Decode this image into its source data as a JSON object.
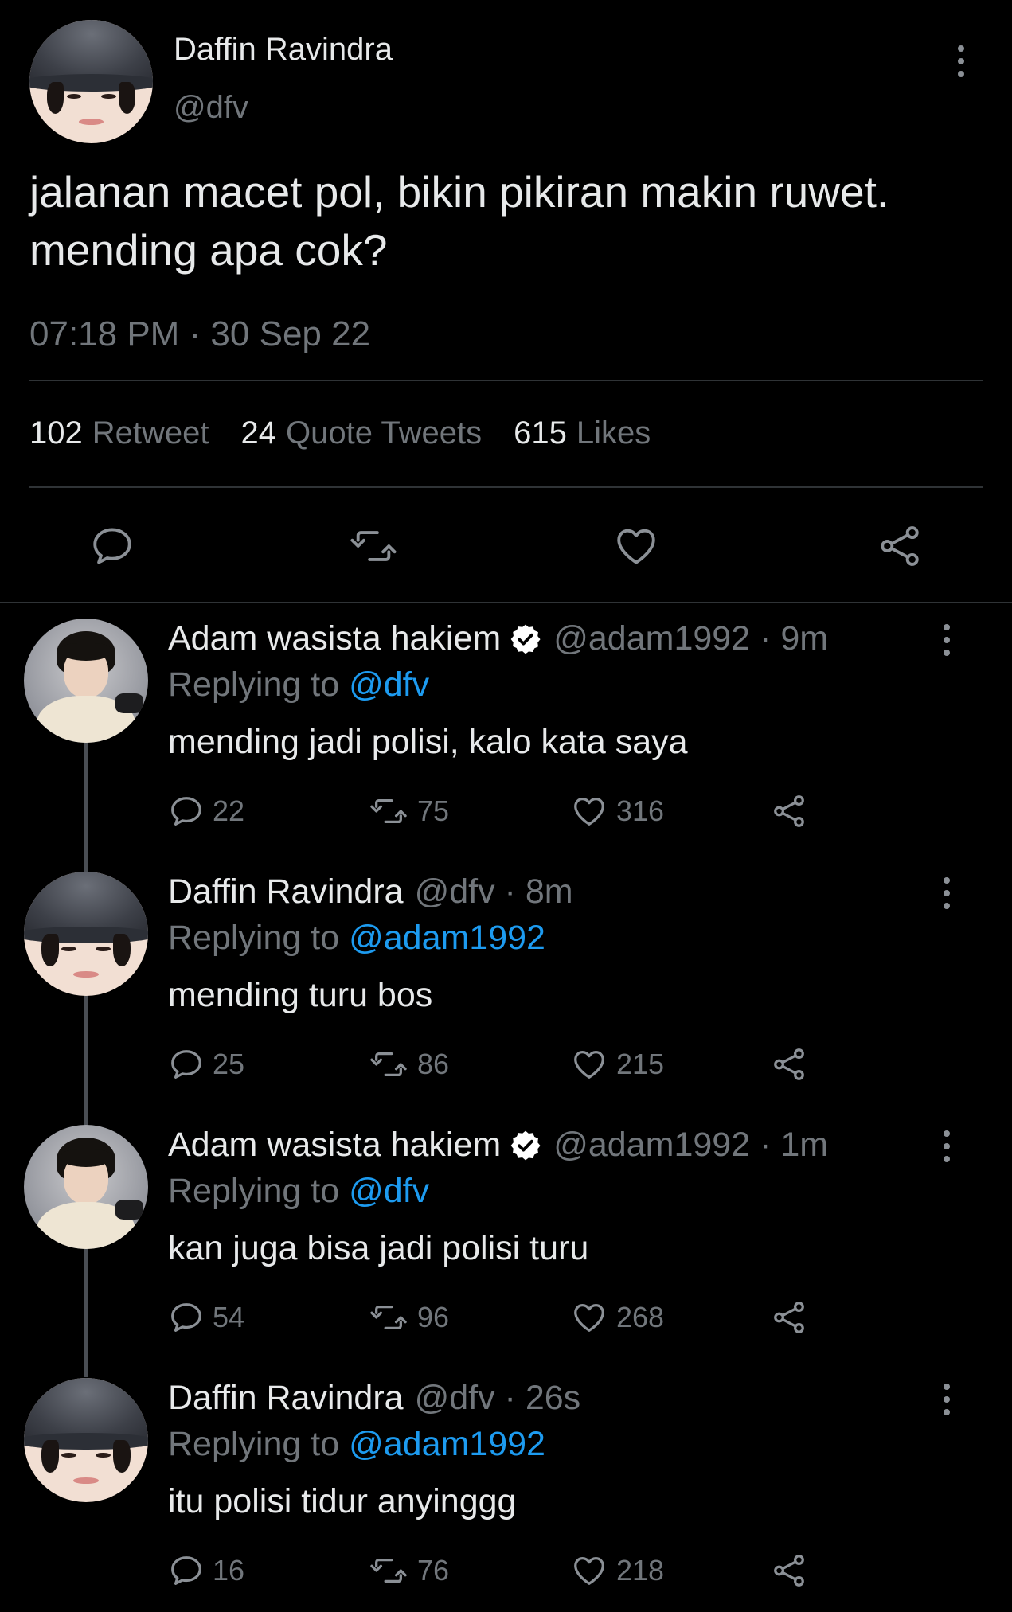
{
  "main_tweet": {
    "author_name": "Daffin Ravindra",
    "author_handle": "@dfv",
    "text": "jalanan macet pol, bikin pikiran makin ruwet. mending apa cok?",
    "timestamp": "07:18 PM · 30 Sep 22",
    "stats": {
      "retweets_count": "102",
      "retweets_label": "Retweet",
      "quotes_count": "24",
      "quotes_label": "Quote Tweets",
      "likes_count": "615",
      "likes_label": "Likes"
    },
    "actions": [
      "reply-icon",
      "retweet-icon",
      "like-icon",
      "share-icon"
    ]
  },
  "replies": [
    {
      "author_name": "Adam wasista hakiem",
      "verified": true,
      "meta": "@adam1992 · 9m",
      "replying_prefix": "Replying to",
      "replying_to": "@dfv",
      "text": "mending jadi polisi, kalo kata saya",
      "reply_count": "22",
      "retweet_count": "75",
      "like_count": "316"
    },
    {
      "author_name": "Daffin Ravindra",
      "verified": false,
      "meta": "@dfv · 8m",
      "replying_prefix": "Replying to",
      "replying_to": "@adam1992",
      "text": "mending turu bos",
      "reply_count": "25",
      "retweet_count": "86",
      "like_count": "215"
    },
    {
      "author_name": "Adam wasista hakiem",
      "verified": true,
      "meta": "@adam1992 · 1m",
      "replying_prefix": "Replying to",
      "replying_to": "@dfv",
      "text": "kan juga bisa jadi polisi turu",
      "reply_count": "54",
      "retweet_count": "96",
      "like_count": "268"
    },
    {
      "author_name": "Daffin Ravindra",
      "verified": false,
      "meta": "@dfv · 26s",
      "replying_prefix": "Replying to",
      "replying_to": "@adam1992",
      "text": "itu polisi tidur anyinggg",
      "reply_count": "16",
      "retweet_count": "76",
      "like_count": "218"
    }
  ],
  "colors": {
    "background": "#000000",
    "text_primary": "#e7e9ea",
    "text_secondary": "#71767b",
    "mention": "#1d9bf0",
    "divider": "#2f3336"
  }
}
